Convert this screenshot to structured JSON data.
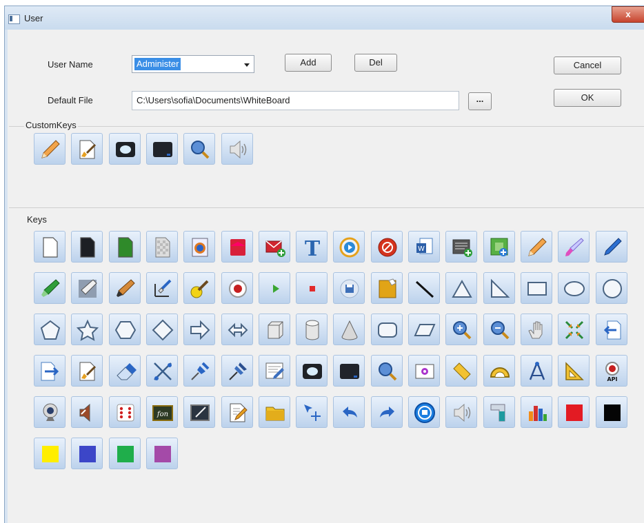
{
  "window": {
    "title": "User",
    "close_label": "x"
  },
  "user": {
    "name_label": "User Name",
    "name_value": "Administer",
    "add_label": "Add",
    "del_label": "Del",
    "cancel_label": "Cancel",
    "ok_label": "OK",
    "default_file_label": "Default File",
    "default_file_value": "C:\\Users\\sofia\\Documents\\WhiteBoard",
    "browse_label": "..."
  },
  "custom_keys": {
    "title": "CustomKeys",
    "icons": [
      "pencil-icon",
      "page-brush-icon",
      "screen-capture-icon",
      "black-screen-icon",
      "magnifier-icon",
      "speaker-icon"
    ]
  },
  "keys": {
    "title": "Keys",
    "icons": [
      "new-page-icon",
      "black-page-icon",
      "green-page-icon",
      "transparent-page-icon",
      "browser-page-icon",
      "red-page-icon",
      "mail-add-icon",
      "text-icon",
      "play-circle-icon",
      "no-entry-icon",
      "word-document-icon",
      "list-add-icon",
      "green-add-icon",
      "pencil-icon",
      "brush-pen-icon",
      "blue-pen-icon",
      "highlighter-icon",
      "pattern-pen-icon",
      "marker-icon",
      "laser-pen-icon",
      "paint-brush-icon",
      "record-icon",
      "play-icon",
      "stop-icon",
      "save-icon",
      "notes-icon",
      "line-icon",
      "triangle-icon",
      "right-triangle-icon",
      "rectangle-icon",
      "ellipse-icon",
      "circle-icon",
      "pentagon-icon",
      "star-icon",
      "hexagon-icon",
      "diamond-icon",
      "arrow-right-icon",
      "double-arrow-icon",
      "cube-icon",
      "cylinder-icon",
      "cone-icon",
      "rounded-rectangle-icon",
      "parallelogram-icon",
      "zoom-in-icon",
      "zoom-out-icon",
      "hand-icon",
      "shrink-icon",
      "import-icon",
      "export-icon",
      "page-brush-icon",
      "eraser-icon",
      "scissors-icon",
      "pin-icon",
      "push-pin-icon",
      "edit-image-icon",
      "screen-capture-icon",
      "black-screen-icon",
      "magnifier-icon",
      "camera-icon",
      "ruler-icon",
      "protractor-icon",
      "compass-icon",
      "set-square-icon",
      "record-api-icon",
      "webcam-icon",
      "volume-icon",
      "dice-icon",
      "formula-icon",
      "board-icon",
      "document-edit-icon",
      "folder-icon",
      "select-move-icon",
      "undo-icon",
      "redo-icon",
      "home-circle-icon",
      "speaker-icon",
      "pipe-icon",
      "bar-chart-icon",
      "red-color-icon",
      "black-color-icon",
      "yellow-color-icon",
      "blue-color-icon",
      "green-color-icon",
      "purple-color-icon"
    ]
  },
  "colors": {
    "selection": "#3a8ee6",
    "swatch_red": "#e31b23",
    "swatch_black": "#050505",
    "swatch_yellow": "#ffee00",
    "swatch_blue": "#3c46c8",
    "swatch_green": "#1fae4b",
    "swatch_purple": "#a44aa8"
  }
}
